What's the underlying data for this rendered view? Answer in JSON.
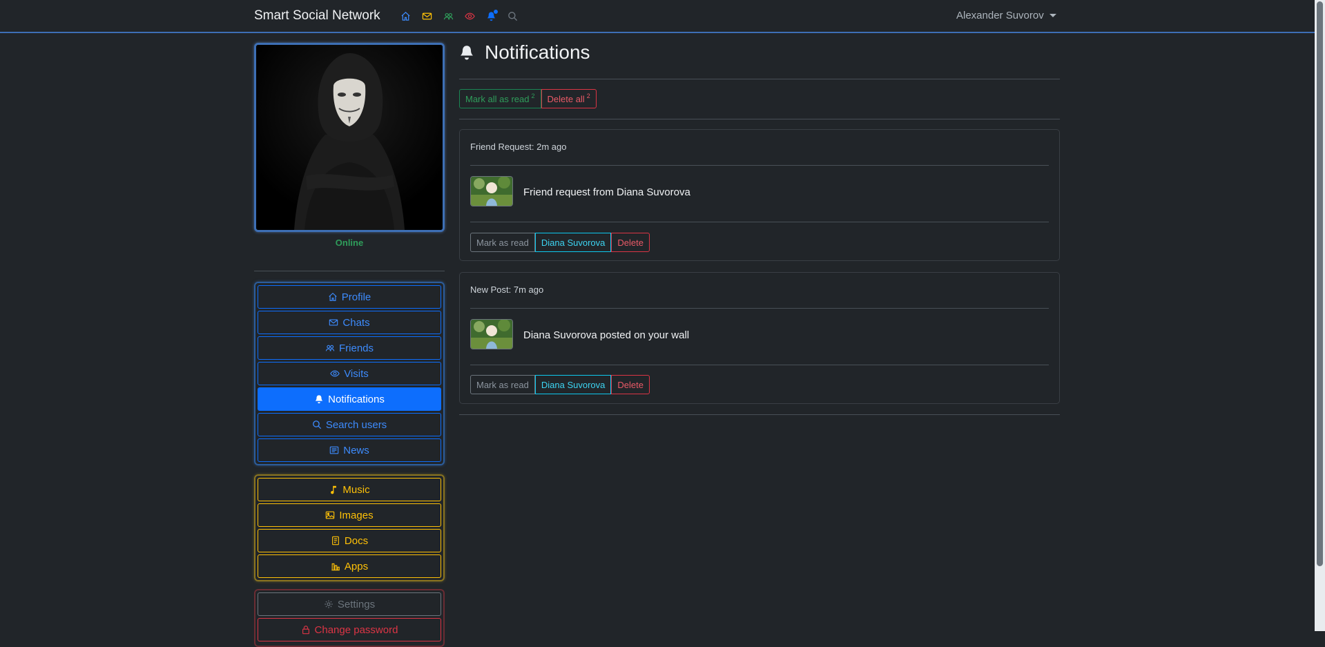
{
  "navbar": {
    "brand": "Smart Social Network",
    "icons": [
      "home-icon",
      "envelope-icon",
      "people-icon",
      "eye-icon",
      "bell-icon",
      "search-icon"
    ],
    "user_name": "Alexander Suvorov"
  },
  "profile": {
    "status": "Online"
  },
  "sidebar": {
    "main_items": [
      {
        "label": "Profile",
        "icon": "home-icon"
      },
      {
        "label": "Chats",
        "icon": "envelope-icon"
      },
      {
        "label": "Friends",
        "icon": "people-icon"
      },
      {
        "label": "Visits",
        "icon": "eye-icon"
      },
      {
        "label": "Notifications",
        "icon": "bell-icon",
        "active": true
      },
      {
        "label": "Search users",
        "icon": "search-icon"
      },
      {
        "label": "News",
        "icon": "newspaper-icon"
      }
    ],
    "media_items": [
      {
        "label": "Music",
        "icon": "music-note-icon"
      },
      {
        "label": "Images",
        "icon": "image-icon"
      },
      {
        "label": "Docs",
        "icon": "document-icon"
      },
      {
        "label": "Apps",
        "icon": "apps-icon"
      }
    ],
    "settings_items": [
      {
        "label": "Settings",
        "icon": "gear-icon"
      },
      {
        "label": "Change password",
        "icon": "lock-icon"
      }
    ]
  },
  "main": {
    "title": "Notifications",
    "mark_all_label": "Mark all as read",
    "mark_all_count": "2",
    "delete_all_label": "Delete all",
    "delete_all_count": "2",
    "notifications": [
      {
        "type": "Friend Request",
        "separator": ":",
        "time": "2m ago",
        "text": "Friend request from Diana Suvorova",
        "mark_label": "Mark as read",
        "user_label": "Diana Suvorova",
        "delete_label": "Delete"
      },
      {
        "type": "New Post",
        "separator": ":",
        "time": "7m ago",
        "text": "Diana Suvorova posted on your wall",
        "mark_label": "Mark as read",
        "user_label": "Diana Suvorova",
        "delete_label": "Delete"
      }
    ]
  },
  "colors": {
    "background": "#212529",
    "primary": "#0d6efd",
    "warning": "#ffc107",
    "success": "#198754",
    "danger": "#dc3545",
    "info": "#0dcaf0"
  }
}
